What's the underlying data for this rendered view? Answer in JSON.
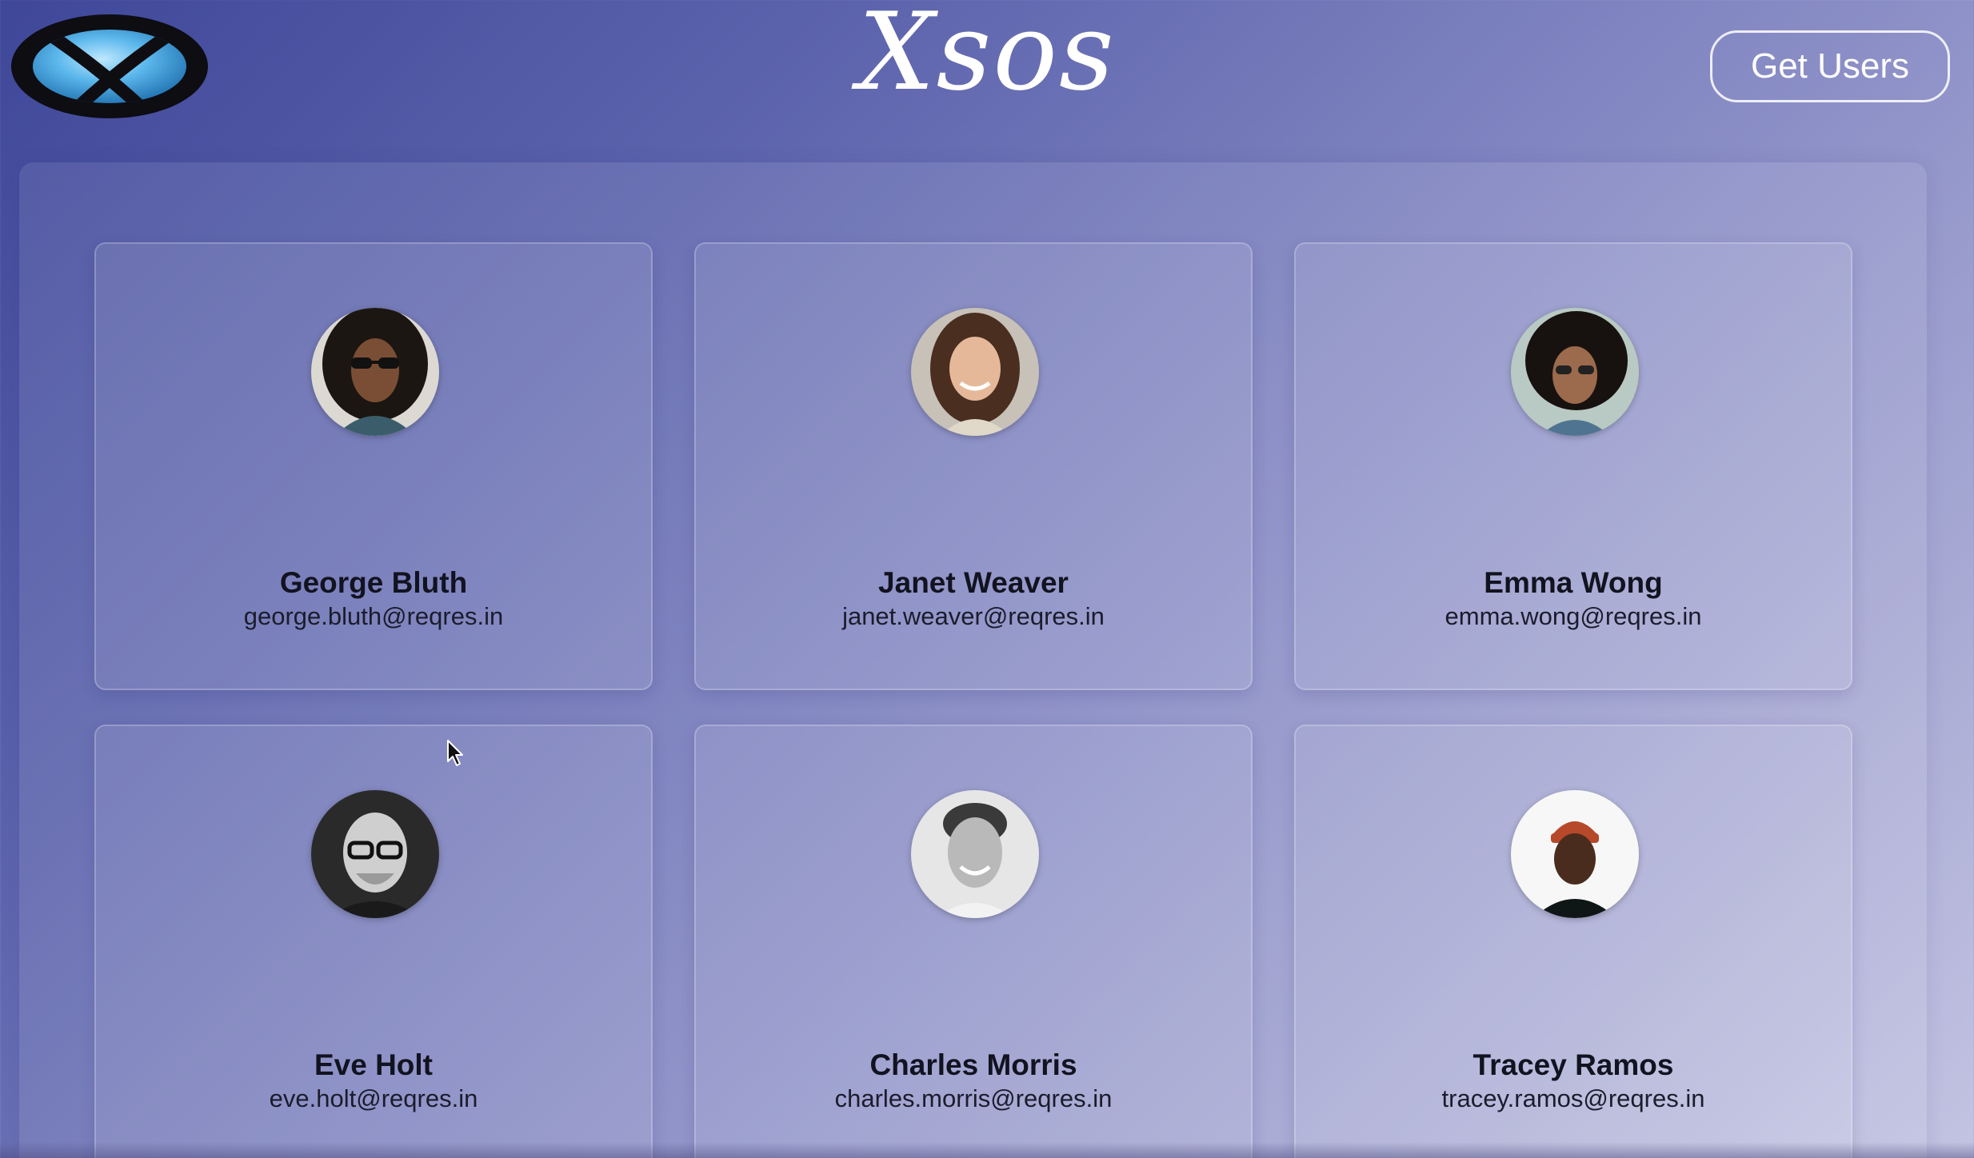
{
  "header": {
    "logo_icon": "xbox-logo-icon",
    "title": "Xsos",
    "get_users_label": "Get Users"
  },
  "colors": {
    "background_start": "#3f4799",
    "background_end": "#c3c4e2",
    "logo_sphere": "#5cb8ec",
    "text_dark": "#121320"
  },
  "users": [
    {
      "name": "George Bluth",
      "email": "george.bluth@reqres.in",
      "avatar_icon": "george-avatar-icon"
    },
    {
      "name": "Janet Weaver",
      "email": "janet.weaver@reqres.in",
      "avatar_icon": "janet-avatar-icon"
    },
    {
      "name": "Emma Wong",
      "email": "emma.wong@reqres.in",
      "avatar_icon": "emma-avatar-icon"
    },
    {
      "name": "Eve Holt",
      "email": "eve.holt@reqres.in",
      "avatar_icon": "eve-avatar-icon"
    },
    {
      "name": "Charles Morris",
      "email": "charles.morris@reqres.in",
      "avatar_icon": "charles-avatar-icon"
    },
    {
      "name": "Tracey Ramos",
      "email": "tracey.ramos@reqres.in",
      "avatar_icon": "tracey-avatar-icon"
    }
  ]
}
